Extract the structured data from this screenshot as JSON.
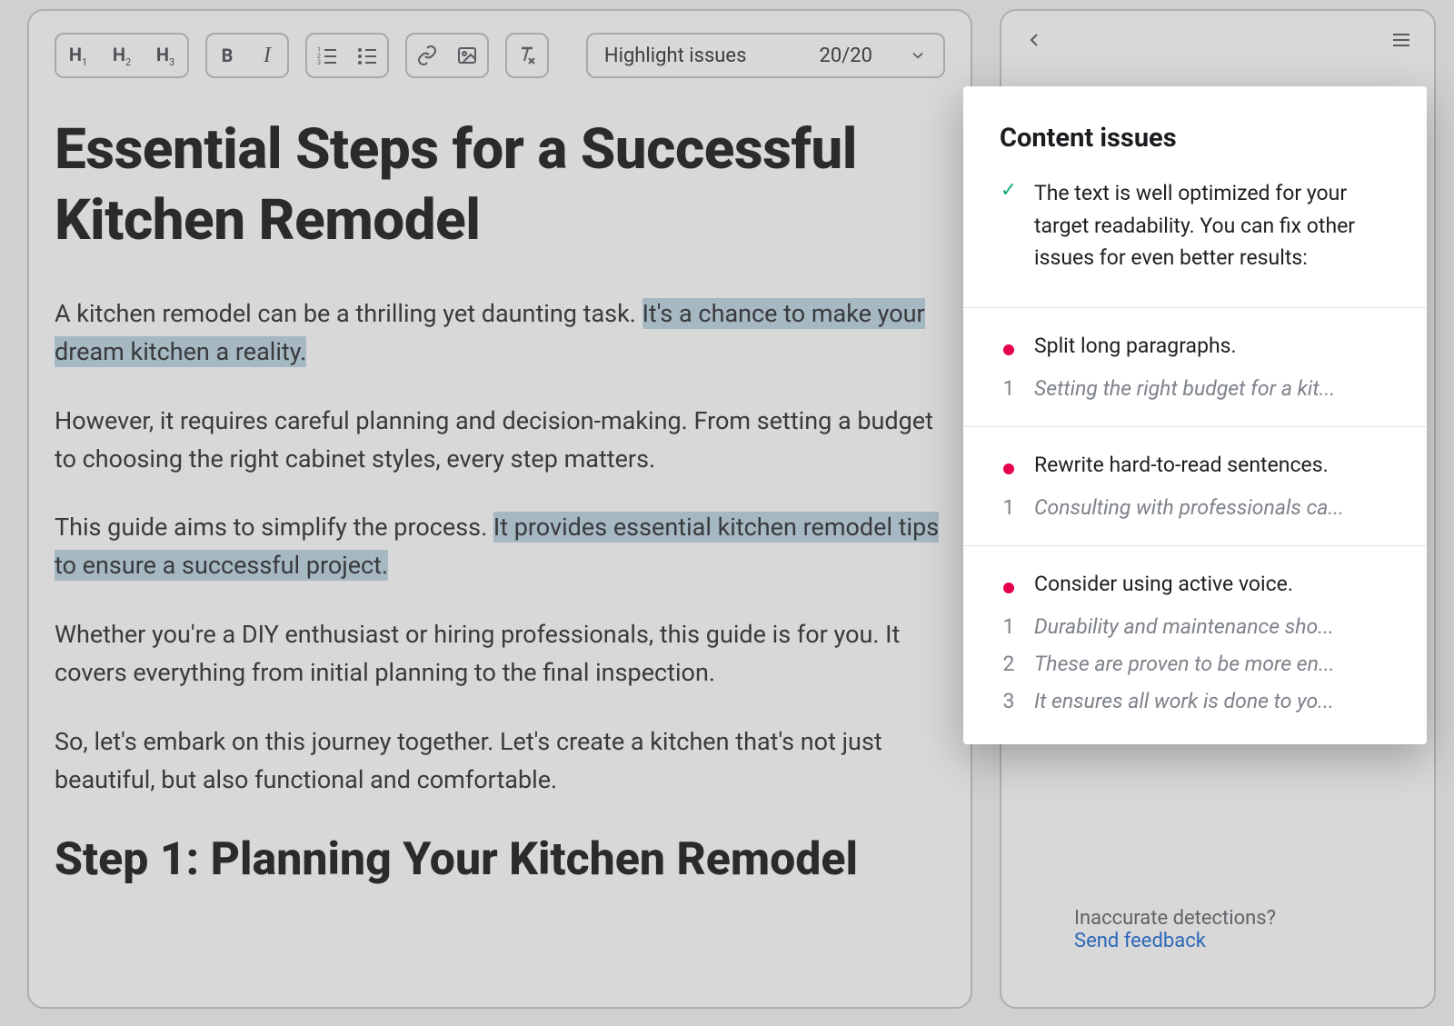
{
  "toolbar": {
    "h1": "H",
    "h1sub": "1",
    "h2": "H",
    "h2sub": "2",
    "h3": "H",
    "h3sub": "3",
    "bold": "B",
    "italic": "I",
    "highlight_label": "Highlight issues",
    "highlight_count": "20/20"
  },
  "document": {
    "title": "Essential Steps for a Successful Kitchen Remodel",
    "p1a": "A kitchen remodel can be a thrilling yet daunting task. ",
    "p1b_hl": "It's a chance to make your dream kitchen a reality.",
    "p2": "However, it requires careful planning and decision-making. From setting a budget to choosing the right cabinet styles, every step matters.",
    "p3a": "This guide aims to simplify the process. ",
    "p3b_hl": "It provides essential kitchen remodel tips to ensure a successful project.",
    "p4": "Whether you're a DIY enthusiast or hiring professionals, this guide is for you. It covers everything from initial planning to the final inspection.",
    "p5": "So, let's embark on this journey together. Let's create a kitchen that's not just beautiful, but also functional and comfortable.",
    "step1_heading": "Step 1: Planning Your Kitchen Remodel"
  },
  "sidebar": {
    "feedback_q": "Inaccurate detections?",
    "feedback_link": "Send feedback"
  },
  "popover": {
    "heading": "Content issues",
    "summary": "The text is well optimized for your target readability. You can fix other issues for even better results:",
    "issues": [
      {
        "title": "Split long paragraphs.",
        "items": [
          {
            "n": "1",
            "text": "Setting the right budget for a kit..."
          }
        ]
      },
      {
        "title": "Rewrite hard-to-read sentences.",
        "items": [
          {
            "n": "1",
            "text": "Consulting with professionals ca..."
          }
        ]
      },
      {
        "title": "Consider using active voice.",
        "items": [
          {
            "n": "1",
            "text": "Durability and maintenance sho..."
          },
          {
            "n": "2",
            "text": "These are proven to be more en..."
          },
          {
            "n": "3",
            "text": "It ensures all work is done to yo..."
          }
        ]
      }
    ]
  }
}
